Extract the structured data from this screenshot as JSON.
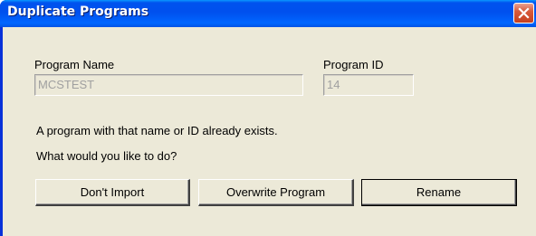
{
  "window": {
    "title": "Duplicate Programs"
  },
  "program_name": {
    "label": "Program Name",
    "value": "MCSTEST"
  },
  "program_id": {
    "label": "Program ID",
    "value": "14"
  },
  "message": {
    "line1": "A program with that name or ID already exists.",
    "line2": "What would you like to do?"
  },
  "buttons": {
    "dont_import": "Don't Import",
    "overwrite": "Overwrite Program",
    "rename": "Rename"
  },
  "icons": {
    "close": "close-icon"
  },
  "colors": {
    "titlebar": "#0054e3",
    "close_button": "#d75b3c",
    "dialog_background": "#ece9d8"
  }
}
